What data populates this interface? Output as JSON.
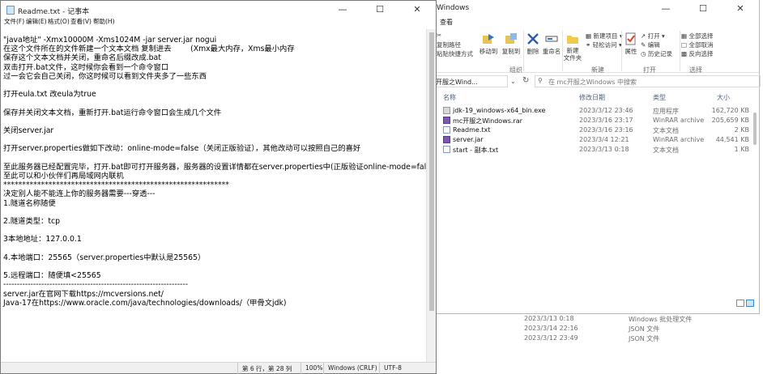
{
  "background_list": {
    "rows": [
      {
        "date": "2023/3/13 0:18",
        "type": "Windows 批处理文件"
      },
      {
        "date": "2023/3/14 22:16",
        "type": "JSON 文件"
      },
      {
        "date": "2023/3/12 23:49",
        "type": "JSON 文件"
      }
    ]
  },
  "explorer": {
    "title": "Windows",
    "menu_view": "查看",
    "ribbon": {
      "cut": "",
      "copy_path": "复制路径",
      "paste_shortcut": "粘贴快捷方式",
      "move_to": "移动到",
      "copy_to": "复制到",
      "delete": "删除",
      "rename": "重命名",
      "new_folder": "新建\n文件夹",
      "new_item": "新建项目",
      "easy_access": "轻松访问",
      "properties": "属性",
      "open": "打开",
      "edit": "编辑",
      "history": "历史记录",
      "select_all": "全部选择",
      "select_none": "全部取消",
      "invert": "反向选择",
      "group_organize": "组织",
      "group_new": "新建",
      "group_open": "打开",
      "group_select": "选择"
    },
    "address": "开服之Wind...",
    "search_placeholder": "在 mc开服之Windows 中搜索",
    "columns": {
      "name": "名称",
      "date": "修改日期",
      "type": "类型",
      "size": "大小"
    },
    "files": [
      {
        "name": "jdk-19_windows-x64_bin.exe",
        "date": "2023/3/12 23:46",
        "type": "应用程序",
        "size": "162,720 KB",
        "icon": "exe-icon"
      },
      {
        "name": "mc开服之Windows.rar",
        "date": "2023/3/16 23:17",
        "type": "WinRAR archive",
        "size": "205,659 KB",
        "icon": "rar-icon"
      },
      {
        "name": "Readme.txt",
        "date": "2023/3/16 23:16",
        "type": "文本文档",
        "size": "2 KB",
        "icon": "txt-icon"
      },
      {
        "name": "server.jar",
        "date": "2023/3/4 12:21",
        "type": "WinRAR archive",
        "size": "44,541 KB",
        "icon": "jar-icon"
      },
      {
        "name": "start - 副本.txt",
        "date": "2023/3/13 0:18",
        "type": "文本文档",
        "size": "1 KB",
        "icon": "txt-icon"
      }
    ]
  },
  "notepad": {
    "title": "Readme.txt - 记事本",
    "menu": [
      "文件(F)",
      "编辑(E)",
      "格式(O)",
      "查看(V)",
      "帮助(H)"
    ],
    "lines": [
      "\"java地址\" -Xmx10000M -Xms1024M -jar server.jar nogui",
      "在这个文件所在的文件新建一个文本文档 复制进去        (Xmx最大内存，Xms最小内存",
      "保存这个文本文档并关闭，重命名后缀改成.bat",
      "双击打开.bat文件，这时候你会看到一个命令窗口",
      "过一会它会自己关闭，你这时候可以看到文件夹多了一些东西",
      "",
      "打开eula.txt 改eula为true",
      "",
      "保存并关闭文本文档，重新打开.bat运行命令窗口会生成几个文件",
      "",
      "关闭server.jar",
      "",
      "打开server.properties做如下改动：online-mode=false（关闭正版验证），其他改动可以按照自己的喜好",
      "",
      "至此服务器已经配置完毕，打开.bat即可打开服务器，服务器的设置详情都在server.properties中(正版验证online-mode=false)",
      "至此可以和小伙伴们再局域网内联机",
      "************************************************************",
      "决定别人能不能连上你的服务器需要---穿透---",
      "1.隧道名称随便",
      "",
      "2.隧道类型：tcp",
      "",
      "3本地地址：127.0.0.1",
      "",
      "4.本地端口：25565（server.properties中默认是25565）",
      "",
      "5.远程端口：随便填<25565",
      "--------------------------------------------------------------------",
      "server.jar在官网下载https://mcversions.net/",
      "Java-17在https://www.oracle.com/java/technologies/downloads/（甲骨文jdk)"
    ],
    "status": {
      "position": "第 6 行，第 28 列",
      "zoom": "100%",
      "line_ending": "Windows (CRLF)",
      "encoding": "UTF-8"
    }
  }
}
